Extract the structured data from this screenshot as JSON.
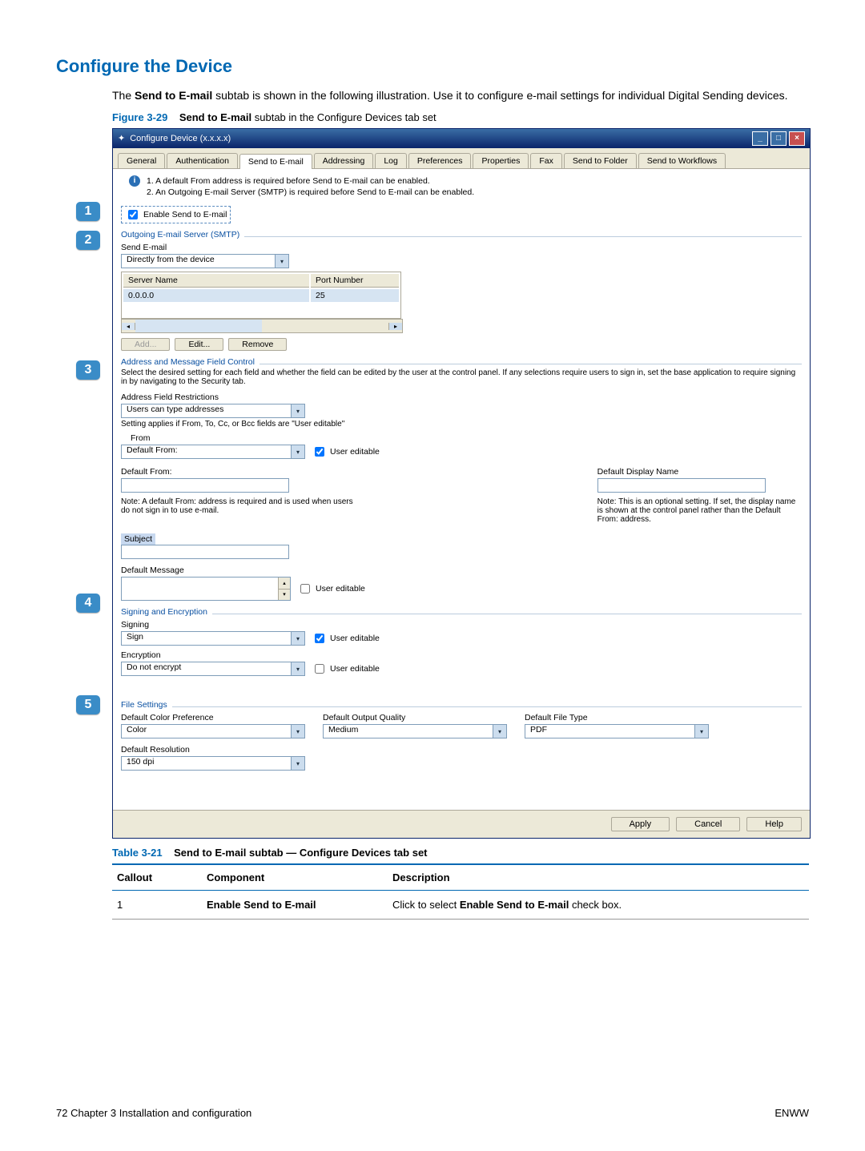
{
  "page": {
    "section_title": "Configure the Device",
    "intro_pre": "The ",
    "intro_bold": "Send to E-mail",
    "intro_post": " subtab is shown in the following illustration. Use it to configure e-mail settings for individual Digital Sending devices.",
    "fig_label": "Figure 3-29",
    "fig_bold": "Send to E-mail",
    "fig_rest": " subtab in the Configure Devices tab set",
    "table_label": "Table 3-21",
    "table_title": "Send to E-mail subtab — Configure Devices tab set",
    "th_callout": "Callout",
    "th_component": "Component",
    "th_desc": "Description",
    "row1": {
      "callout": "1",
      "component": "Enable Send to E-mail",
      "desc_pre": "Click to select ",
      "desc_bold": "Enable Send to E-mail",
      "desc_post": " check box."
    },
    "footer_left_pre": "72    Chapter 3   Installation and configuration",
    "footer_right": "ENWW"
  },
  "callouts": [
    "1",
    "2",
    "3",
    "4",
    "5"
  ],
  "win": {
    "title": "Configure Device (x.x.x.x)",
    "tabs": [
      "General",
      "Authentication",
      "Send to E-mail",
      "Addressing",
      "Log",
      "Preferences",
      "Properties",
      "Fax",
      "Send to Folder",
      "Send to Workflows"
    ],
    "active_tab": "Send to E-mail",
    "info1": "1.  A default From address is required before Send to E-mail can be enabled.",
    "info2": "2.  An Outgoing E-mail Server (SMTP) is required before Send to E-mail can be enabled.",
    "enable_label": "Enable Send to E-mail",
    "smtp_group": "Outgoing E-mail Server (SMTP)",
    "send_email_label": "Send E-mail",
    "send_email_value": "Directly from the device",
    "server_name_h": "Server Name",
    "port_h": "Port Number",
    "server_name_v": "0.0.0.0",
    "port_v": "25",
    "btn_add": "Add...",
    "btn_edit": "Edit...",
    "btn_remove": "Remove",
    "addr_group": "Address and Message Field Control",
    "addr_text": "Select the desired setting for each field and whether the field can be edited by the user at the control panel. If any selections require users to sign in, set the base application to require signing in by navigating to the Security tab.",
    "addr_rest_label": "Address Field Restrictions",
    "addr_rest_value": "Users can type addresses",
    "addr_applies": "Setting applies if From, To, Cc, or Bcc fields are \"User editable\"",
    "from_label": "From",
    "from_value": "Default From:",
    "user_editable": "User editable",
    "default_from_label": "Default From:",
    "default_display_label": "Default Display Name",
    "from_note": "Note: A default From: address is required and is used when users do not sign in to use e-mail.",
    "display_note": "Note: This is an optional setting.  If set, the display name is shown at the control panel rather than the Default From: address.",
    "subject_label": "Subject",
    "default_msg_label": "Default Message",
    "sign_group": "Signing and Encryption",
    "signing_label": "Signing",
    "signing_value": "Sign",
    "enc_label": "Encryption",
    "enc_value": "Do not encrypt",
    "file_group": "File Settings",
    "color_label": "Default Color Preference",
    "color_value": "Color",
    "quality_label": "Default Output Quality",
    "quality_value": "Medium",
    "filetype_label": "Default File Type",
    "filetype_value": "PDF",
    "res_label": "Default Resolution",
    "res_value": "150 dpi",
    "btn_apply": "Apply",
    "btn_cancel": "Cancel",
    "btn_help": "Help"
  }
}
